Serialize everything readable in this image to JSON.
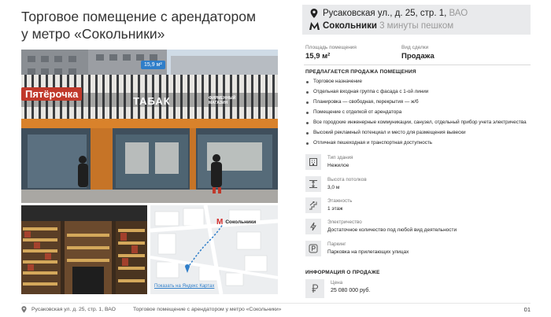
{
  "header": {
    "title_line1": "Торговое помещение с арендатором",
    "title_line2": "у метро «Сокольники»"
  },
  "address": {
    "street": "Русаковская ул., д. 25, стр. 1,",
    "district": "ВАО",
    "metro": "Сокольники",
    "metro_walk": "3 минуты пешком",
    "pin_icon": "location-pin-icon",
    "metro_icon": "metro-m-icon"
  },
  "stats": {
    "area_label": "Площадь помещения",
    "area_value": "15,9 м²",
    "deal_label": "Вид сделки",
    "deal_value": "Продажа"
  },
  "features": {
    "title": "ПРЕДЛАГАЕТСЯ ПРОДАЖА ПОМЕЩЕНИЯ",
    "items": [
      "Торговое назначение",
      "Отдельная входная группа с фасада с 1-ой линии",
      "Планировка — свободная, перекрытия — ж/б",
      "Помещение с отделкой от арендатора",
      "Все городские инженерные коммуникации, санузел, отдельный прибор учета электричества",
      "Высокий рекламный потенциал и место для размещения вывески",
      "Отличная пешеходная и транспортная доступность"
    ]
  },
  "specs": [
    {
      "icon": "building-icon",
      "label": "Тип здания",
      "value": "Нежилое"
    },
    {
      "icon": "ceiling-height-icon",
      "label": "Высота потолков",
      "value": "3,0 м"
    },
    {
      "icon": "stairs-icon",
      "label": "Этажность",
      "value": "1 этаж"
    },
    {
      "icon": "lightning-icon",
      "label": "Электричество",
      "value": "Достаточное количество под любой вид деятельности"
    },
    {
      "icon": "parking-icon",
      "label": "Паркинг",
      "value": "Парковка на прилегающих улицах"
    }
  ],
  "sale": {
    "title": "ИНФОРМАЦИЯ О ПРОДАЖЕ",
    "price_label": "Цена",
    "price_value": "25 080 000 руб.",
    "icon": "ruble-icon"
  },
  "photo": {
    "area_badge": "15,9 м²",
    "sign_pyaterochka": "Пятёрочка",
    "sign_tabak": "ТАБАК",
    "sign_firm": "ФИРМЕННЫЙ МАГАЗИН"
  },
  "map": {
    "metro_label": "Сокольники",
    "yandex_link": "Показать на Яндекс Картах"
  },
  "footer": {
    "address": "Русаковская ул. д. 25, стр. 1, ВАО",
    "title": "Торговое помещение с арендатором у метро «Сокольники»",
    "page": "01"
  },
  "colors": {
    "accent_orange": "#d9822b",
    "metro_red": "#d32f2f",
    "box_gray": "#e9eaec",
    "route_blue": "#2f7ec9"
  }
}
